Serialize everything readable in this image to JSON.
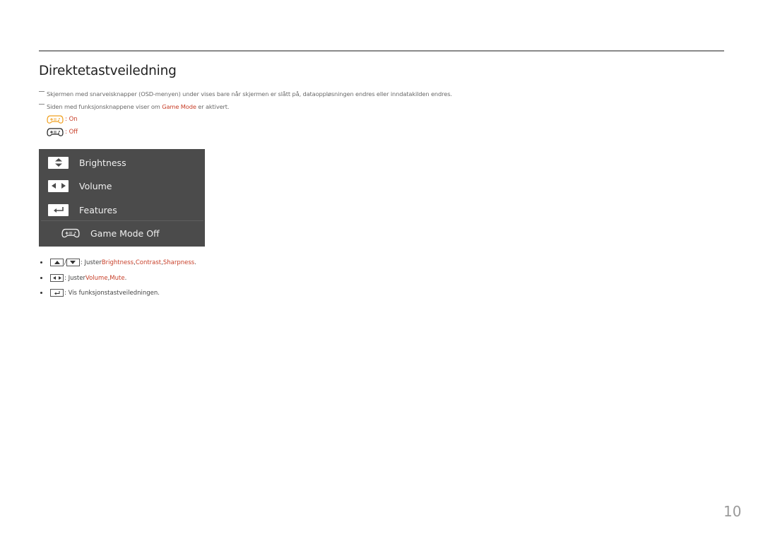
{
  "page": {
    "title": "Direktetastveiledning",
    "page_number": "10"
  },
  "notes": [
    {
      "text": "Skjermen med snarveisknapper (OSD-menyen) under vises bare når skjermen er slått på, dataoppløsningen endres eller inndatakilden endres."
    },
    {
      "before": "Siden med funksjonsknappene viser om ",
      "highlight": "Game Mode",
      "after": " er aktivert."
    }
  ],
  "legend": [
    {
      "icon": "gamepad-icon",
      "color": "#f0a020",
      "label": ": On"
    },
    {
      "icon": "gamepad-icon",
      "color": "#222222",
      "label": ": Off"
    }
  ],
  "osd": {
    "items": [
      {
        "icon": "up-down-arrows-icon",
        "label": "Brightness"
      },
      {
        "icon": "left-right-arrows-icon",
        "label": "Volume"
      },
      {
        "icon": "enter-icon",
        "label": "Features"
      }
    ],
    "game_mode": {
      "icon": "gamepad-icon",
      "label": "Game Mode Off"
    }
  },
  "bullets": [
    {
      "sep": "/",
      "prefix": ": Juster ",
      "links": [
        "Brightness",
        "Contrast",
        "Sharpness"
      ],
      "comma": ", ",
      "suffix": "."
    },
    {
      "prefix": ": Juster ",
      "links": [
        "Volume",
        "Mute"
      ],
      "comma": ", ",
      "suffix": "."
    },
    {
      "prefix": ": Vis funksjonstastveiledningen."
    }
  ],
  "colors": {
    "highlight": "#c8402a",
    "osd_background": "#4b4b4b",
    "game_on": "#f0a020"
  }
}
